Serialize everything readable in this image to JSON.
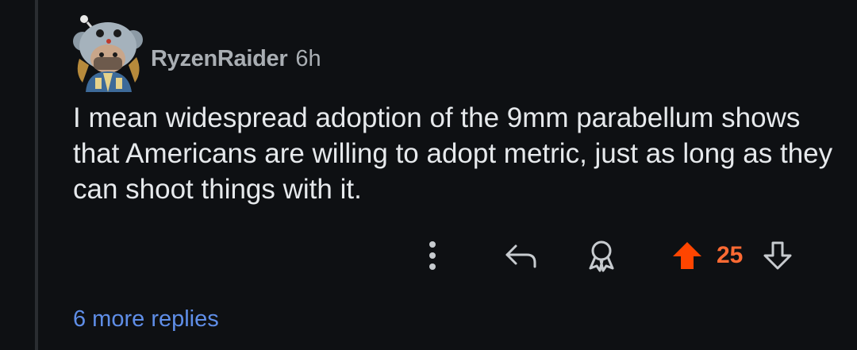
{
  "comment": {
    "author": "RyzenRaider",
    "age": "6h",
    "body": "I mean widespread adoption of the 9mm parabellum shows that Americans are willing to adopt metric, just as long as they can shoot things with it.",
    "score": "25",
    "more_replies": "6 more replies"
  },
  "icons": {
    "more": "vertical-dots-icon",
    "reply": "reply-arrow-icon",
    "award": "award-ribbon-icon",
    "upvote": "upvote-arrow-icon",
    "downvote": "downvote-arrow-icon"
  },
  "colors": {
    "background": "#0e1013",
    "upvote_active": "#ff4500",
    "score": "#ff6a33",
    "link": "#5f8ee8",
    "text": "#e6e9ec",
    "meta": "#a9aeb3"
  }
}
